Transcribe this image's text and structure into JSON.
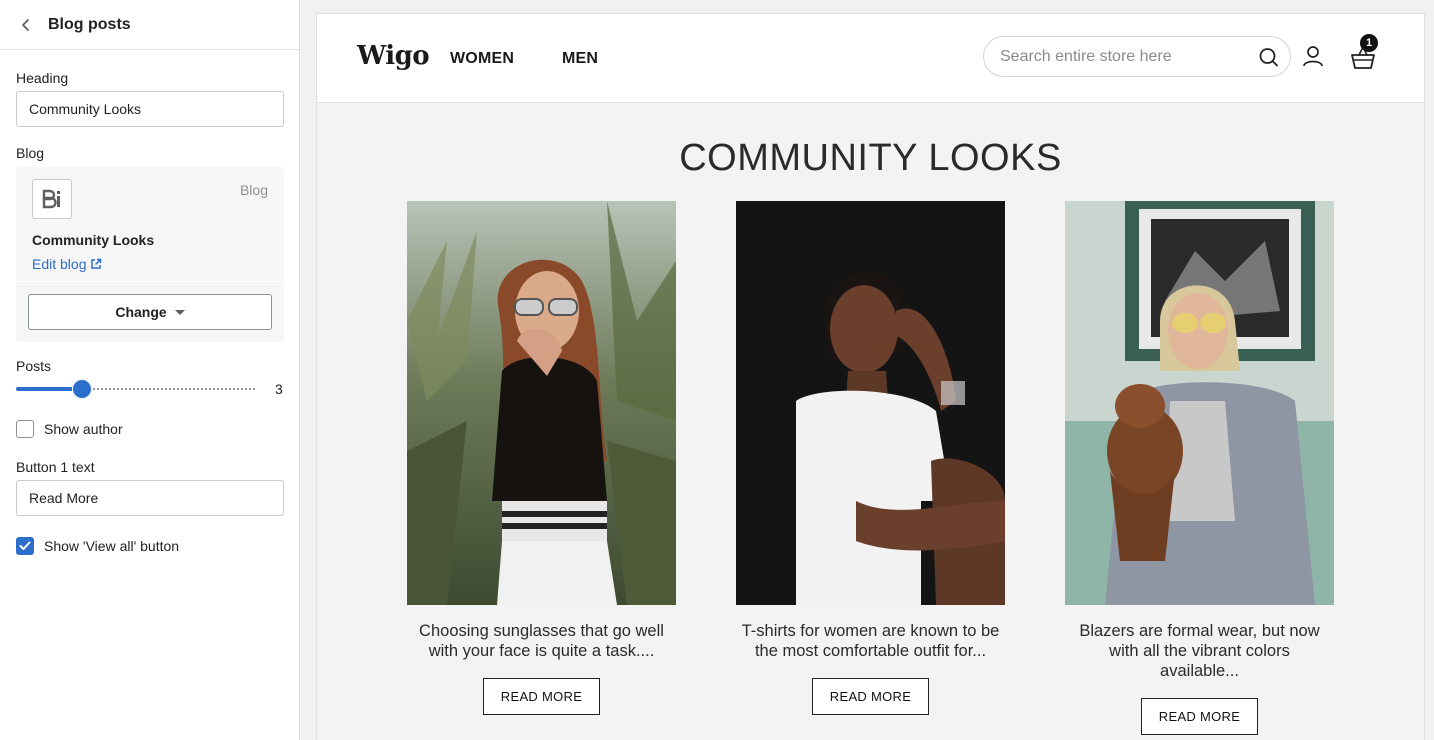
{
  "panel": {
    "title": "Blog posts",
    "heading_label": "Heading",
    "heading_value": "Community Looks",
    "blog_label": "Blog",
    "blog_card": {
      "type": "Blog",
      "name": "Community Looks",
      "edit_link": "Edit blog",
      "change_button": "Change"
    },
    "posts_label": "Posts",
    "posts_value": "3",
    "posts_slider": {
      "min": 1,
      "max": 12,
      "value": 3
    },
    "show_author_label": "Show author",
    "show_author_checked": false,
    "button_text_label": "Button 1 text",
    "button_text_value": "Read More",
    "show_view_all_label": "Show 'View all' button",
    "show_view_all_checked": true
  },
  "store": {
    "logo": "Wigo",
    "nav": [
      "WOMEN",
      "MEN"
    ],
    "search_placeholder": "Search entire store here",
    "cart_count": "1"
  },
  "section": {
    "title": "COMMUNITY LOOKS",
    "posts": [
      {
        "excerpt": "Choosing sunglasses that go well with your face is quite a task....",
        "button": "READ MORE"
      },
      {
        "excerpt": "T-shirts for women are known to be the most comfortable outfit for...",
        "button": "READ MORE"
      },
      {
        "excerpt": "Blazers are formal wear, but now with all the vibrant colors available...",
        "button": "READ MORE"
      }
    ]
  },
  "colors": {
    "accent": "#2c6ecb",
    "link": "#2c6ecb",
    "preview_bg": "#f3f3f3"
  }
}
